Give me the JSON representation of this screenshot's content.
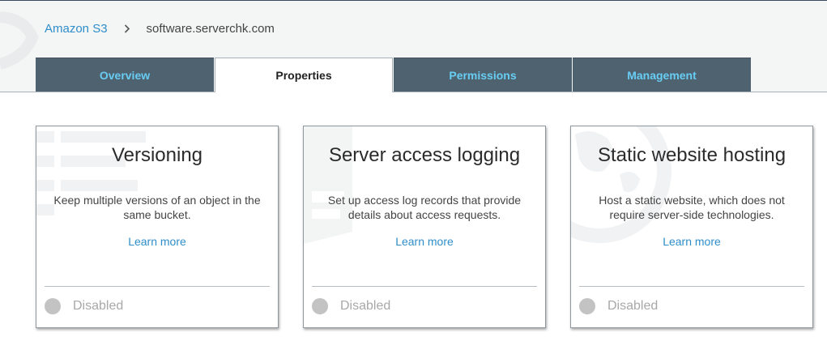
{
  "breadcrumb": {
    "root": "Amazon S3",
    "separator_icon": "chevron-right-icon",
    "current": "software.serverchk.com"
  },
  "tabs": [
    {
      "label": "Overview",
      "active": false
    },
    {
      "label": "Properties",
      "active": true
    },
    {
      "label": "Permissions",
      "active": false
    },
    {
      "label": "Management",
      "active": false
    }
  ],
  "cards": [
    {
      "title": "Versioning",
      "description": "Keep multiple versions of an object in the same bucket.",
      "link": "Learn more",
      "status": "Disabled"
    },
    {
      "title": "Server access logging",
      "description": "Set up access log records that provide details about access requests.",
      "link": "Learn more",
      "status": "Disabled"
    },
    {
      "title": "Static website hosting",
      "description": "Host a static website, which does not require server-side technologies.",
      "link": "Learn more",
      "status": "Disabled"
    }
  ],
  "colors": {
    "tab_background": "#4f6270",
    "tab_text": "#68cdf3",
    "link": "#2f8ec9",
    "status_dot": "#c3c3c3"
  }
}
